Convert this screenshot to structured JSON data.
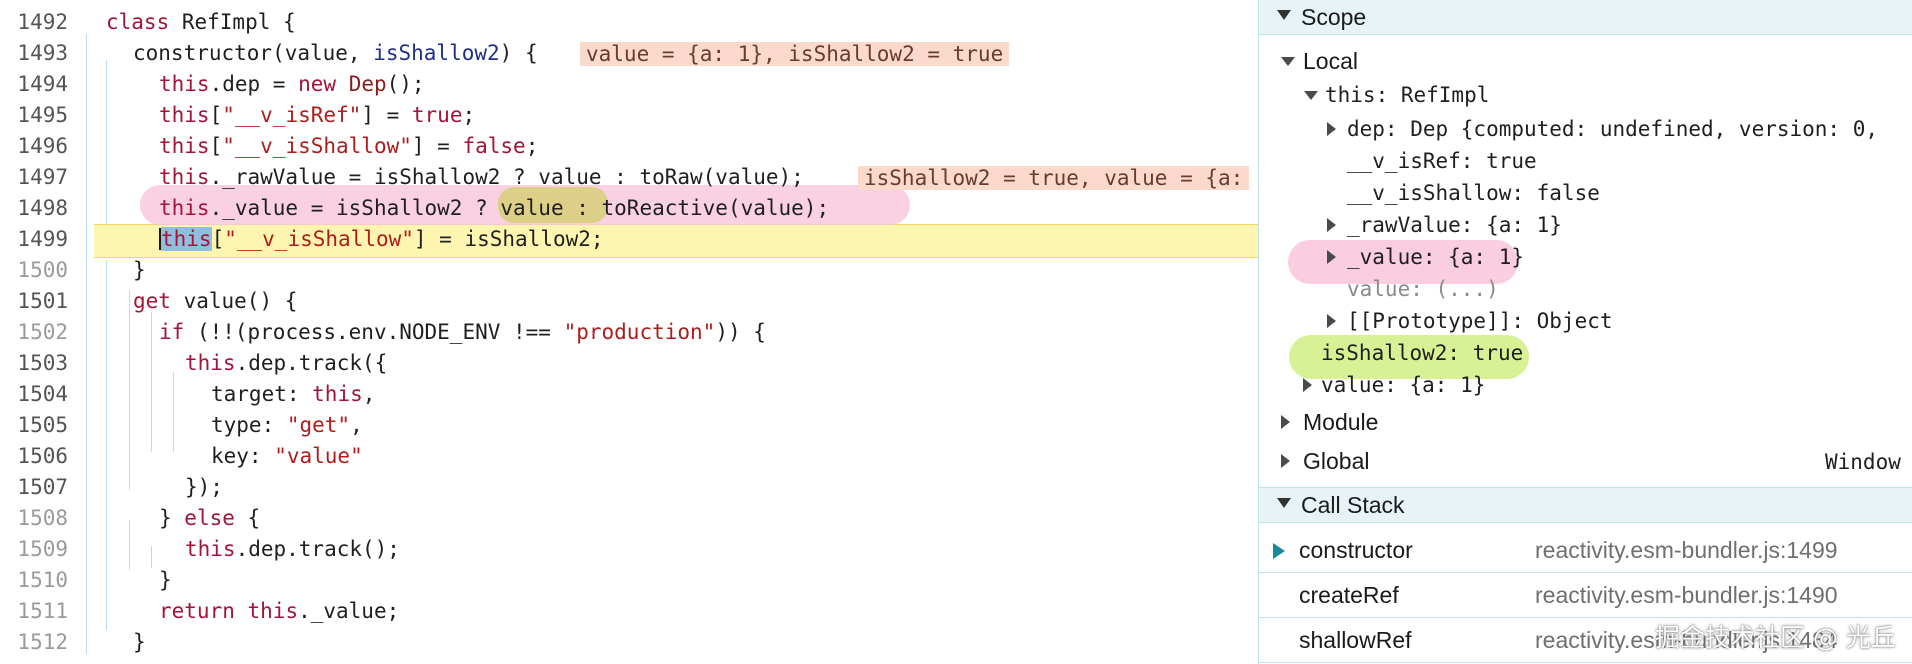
{
  "editor": {
    "inline_values": {
      "constructor": "value = {a: 1}, isShallow2 = true",
      "rawValue": "isShallow2 = true, value = {a:"
    },
    "lines": [
      {
        "num": "1492",
        "code": "class RefImpl {"
      },
      {
        "num": "1493",
        "code": "constructor(value, isShallow2) {"
      },
      {
        "num": "1494",
        "code": "this.dep = new Dep();"
      },
      {
        "num": "1495",
        "code": "this[\"__v_isRef\"] = true;"
      },
      {
        "num": "1496",
        "code": "this[\"__v_isShallow\"] = false;"
      },
      {
        "num": "1497",
        "code": "this._rawValue = isShallow2 ? value : toRaw(value);"
      },
      {
        "num": "1498",
        "code": "this._value = isShallow2 ? value : toReactive(value);"
      },
      {
        "num": "1499",
        "code": "this[\"__v_isShallow\"] = isShallow2;"
      },
      {
        "num": "1500",
        "code": "}"
      },
      {
        "num": "1501",
        "code": "get value() {"
      },
      {
        "num": "1502",
        "code": "if (!!(process.env.NODE_ENV !== \"production\")) {"
      },
      {
        "num": "1503",
        "code": "this.dep.track({"
      },
      {
        "num": "1504",
        "code": "target: this,"
      },
      {
        "num": "1505",
        "code": "type: \"get\","
      },
      {
        "num": "1506",
        "code": "key: \"value\""
      },
      {
        "num": "1507",
        "code": "});"
      },
      {
        "num": "1508",
        "code": "} else {"
      },
      {
        "num": "1509",
        "code": "this.dep.track();"
      },
      {
        "num": "1510",
        "code": "}"
      },
      {
        "num": "1511",
        "code": "return this._value;"
      },
      {
        "num": "1512",
        "code": "}"
      }
    ]
  },
  "scope": {
    "title": "Scope",
    "local_label": "Local",
    "this_label": "this: RefImpl",
    "dep_line": "dep: Dep {computed: undefined, version: 0,",
    "isRef_line": "__v_isRef: true",
    "isShallow_line": "__v_isShallow: false",
    "rawValue_line": "_rawValue: {a: 1}",
    "value_priv_line": "_value: {a: 1}",
    "value_getter_line": "value: (...)",
    "prototype_line": "[[Prototype]]: Object",
    "isShallow2_line": "isShallow2: true",
    "value_arg_line": "value: {a: 1}",
    "module_label": "Module",
    "global_label": "Global",
    "global_value": "Window"
  },
  "call_stack": {
    "title": "Call Stack",
    "frames": [
      {
        "fn": "constructor",
        "loc": "reactivity.esm-bundler.js:1499"
      },
      {
        "fn": "createRef",
        "loc": "reactivity.esm-bundler.js:1490"
      },
      {
        "fn": "shallowRef",
        "loc": "reactivity.esm-bundler.js:1484"
      }
    ]
  },
  "watermark": "掘金技术社区 @ 光丘",
  "colors": {
    "paused_line": "#fdf5b0",
    "inline_value_bg": "#fbd9cd",
    "highlight_pink": "#f9c8de",
    "highlight_green": "#d4ef8a",
    "highlight_olive": "#d4cf6a",
    "panel_header_bg": "#e7f3f7"
  }
}
